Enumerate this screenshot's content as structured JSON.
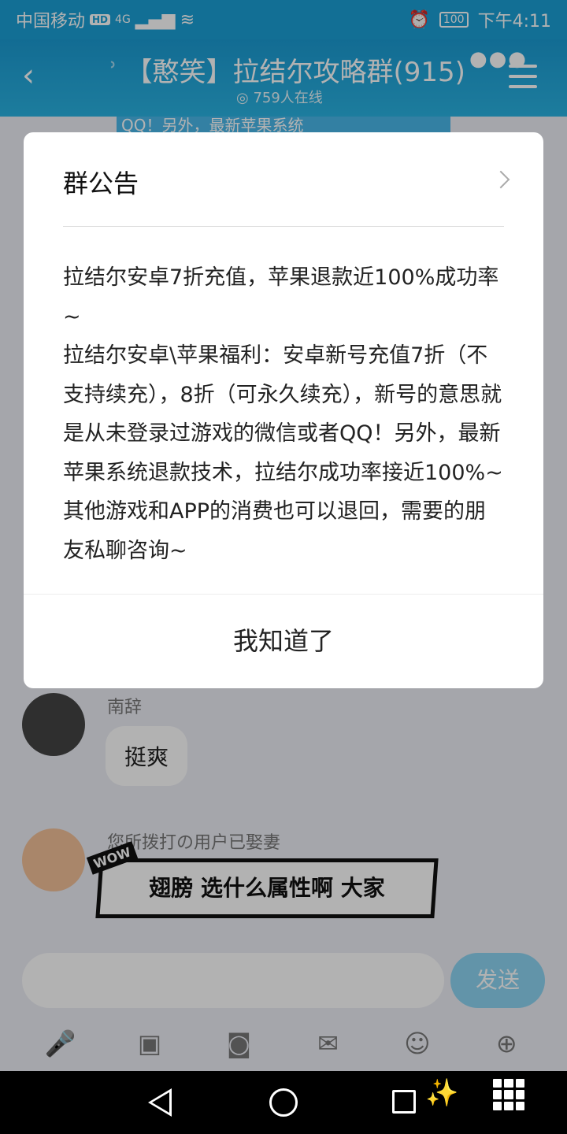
{
  "status_bar": {
    "carrier": "中国移动",
    "hd": "HD",
    "network": "4G",
    "battery": "100",
    "time": "下午4:11"
  },
  "header": {
    "title": "【憨笑】拉结尔攻略群(915)",
    "online": "759人在线",
    "icons": [
      "back-icon",
      "ear-icon",
      "more-icon",
      "menu-icon"
    ]
  },
  "chat": {
    "messages": [
      {
        "sender": "南辞",
        "text": "挺爽"
      },
      {
        "sender": "您所拨打の用户已娶妻",
        "sticker_text": "翅膀 选什么属性啊 大家",
        "sticker_badge": "WOW"
      }
    ],
    "background_banner_text": "QQ！另外，最新苹果系统"
  },
  "input_bar": {
    "placeholder": "",
    "send_label": "发送",
    "tools": [
      "microphone-icon",
      "image-icon",
      "camera-icon",
      "red-packet-icon",
      "emoji-icon",
      "plus-icon"
    ]
  },
  "dialog": {
    "title": "群公告",
    "body": "拉结尔安卓7折充值，苹果退款近100%成功率~\n拉结尔安卓\\苹果福利：安卓新号充值7折（不支持续充），8折（可永久续充），新号的意思就是从未登录过游戏的微信或者QQ！另外，最新苹果系统退款技术，拉结尔成功率接近100%~其他游戏和APP的消费也可以退回，需要的朋友私聊咨询~",
    "button": "我知道了"
  },
  "colors": {
    "header": "#1aa0d6",
    "send_button": "#8dd4f3"
  }
}
